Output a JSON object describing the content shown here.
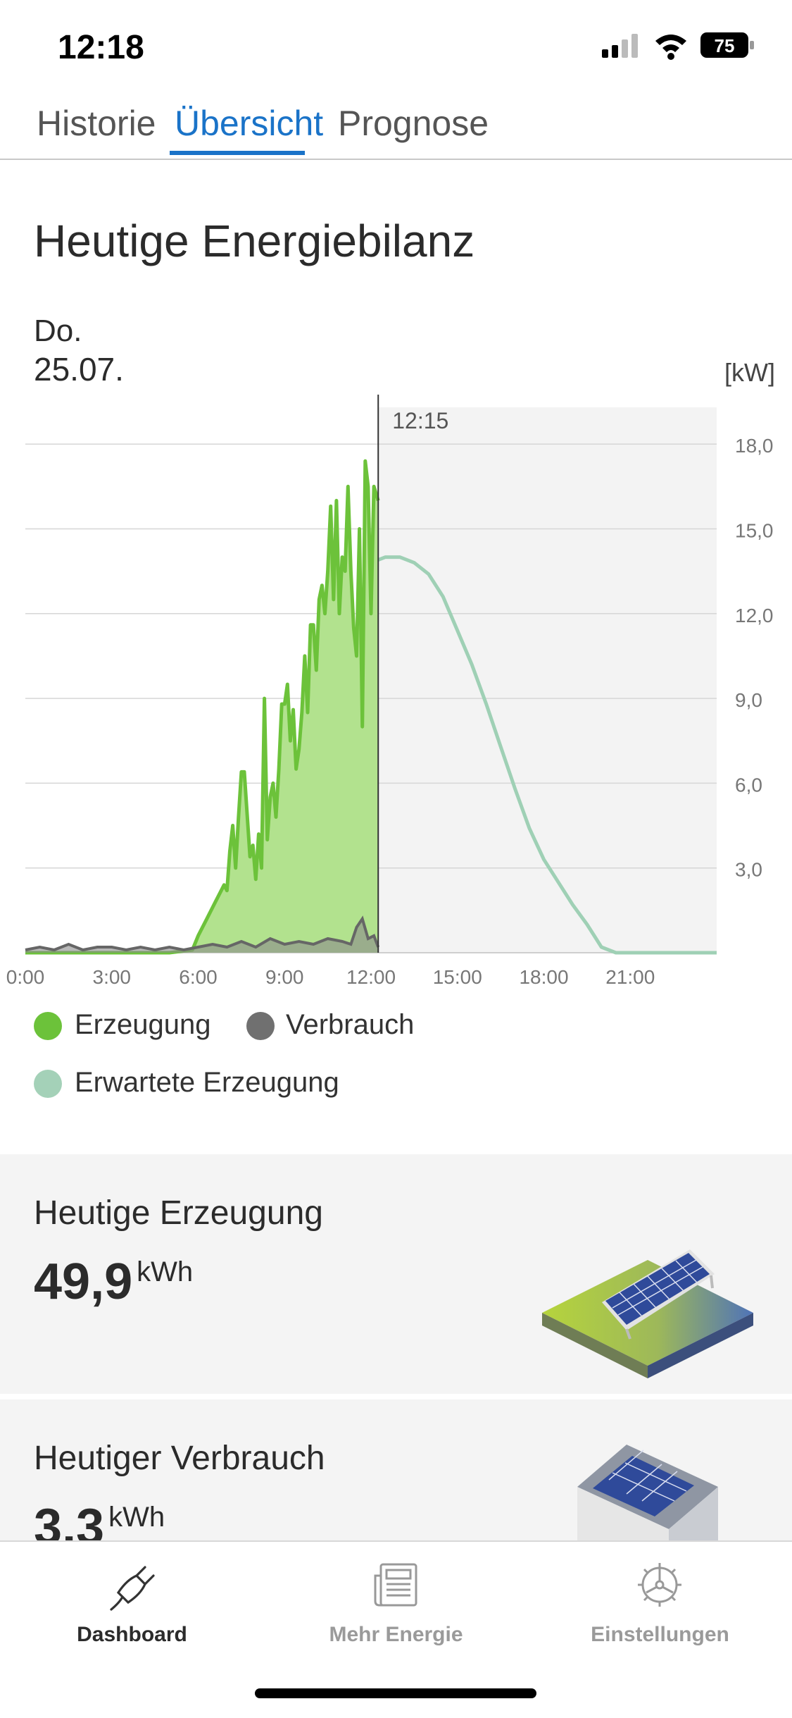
{
  "status_bar": {
    "time": "12:18",
    "battery": "75"
  },
  "tabs": [
    {
      "label": "Historie"
    },
    {
      "label": "Übersicht",
      "active": true
    },
    {
      "label": "Prognose"
    }
  ],
  "header": {
    "title": "Heutige Energiebilanz",
    "day": "Do.",
    "date": "25.07."
  },
  "chart_data": {
    "type": "area",
    "unit": "[kW]",
    "now_marker": "12:15",
    "now_hour": 12.25,
    "xlim": [
      0,
      24
    ],
    "ylim": [
      0,
      19.5
    ],
    "x_tick_labels": [
      "0:00",
      "3:00",
      "6:00",
      "9:00",
      "12:00",
      "15:00",
      "18:00",
      "21:00"
    ],
    "y_tick_labels": [
      "3,0",
      "6,0",
      "9,0",
      "12,0",
      "15,0",
      "18,0"
    ],
    "grid": true,
    "legend_position": "bottom",
    "colors": {
      "generation": "#6cc23a",
      "generation_fill": "#b2e28e",
      "consumption": "#666666",
      "expected": "#9fd0b5",
      "forecast_bg": "#f3f3f3"
    },
    "series": [
      {
        "name": "Erzeugung",
        "x": [
          0,
          1,
          2,
          3,
          4,
          5,
          5.8,
          6,
          6.3,
          6.6,
          6.9,
          7.0,
          7.1,
          7.2,
          7.3,
          7.4,
          7.5,
          7.6,
          7.8,
          7.9,
          8.0,
          8.1,
          8.2,
          8.3,
          8.4,
          8.5,
          8.6,
          8.7,
          8.8,
          8.9,
          9.0,
          9.1,
          9.2,
          9.3,
          9.4,
          9.5,
          9.6,
          9.7,
          9.8,
          9.9,
          10.0,
          10.1,
          10.2,
          10.3,
          10.4,
          10.5,
          10.6,
          10.7,
          10.8,
          10.9,
          11.0,
          11.1,
          11.2,
          11.3,
          11.4,
          11.5,
          11.6,
          11.7,
          11.8,
          11.9,
          12.0,
          12.1,
          12.25
        ],
        "y": [
          0,
          0,
          0,
          0,
          0,
          0,
          0.1,
          0.6,
          1.2,
          1.8,
          2.4,
          2.2,
          3.6,
          4.5,
          3.0,
          4.8,
          6.4,
          6.4,
          3.4,
          3.8,
          2.6,
          4.2,
          3.0,
          9.0,
          4.0,
          5.5,
          6.0,
          4.8,
          6.5,
          8.8,
          8.8,
          9.5,
          7.5,
          8.6,
          6.5,
          7.2,
          8.5,
          10.5,
          8.5,
          11.6,
          11.6,
          10.0,
          12.5,
          13.0,
          12.0,
          13.5,
          15.8,
          12.5,
          16.0,
          12.0,
          14.0,
          13.5,
          16.5,
          13.5,
          11.5,
          10.5,
          15.0,
          8.0,
          17.4,
          16.5,
          12.0,
          16.5,
          16.0
        ]
      },
      {
        "name": "Verbrauch",
        "x": [
          0,
          0.5,
          1,
          1.5,
          2,
          2.5,
          3,
          3.5,
          4,
          4.5,
          5,
          5.5,
          6,
          6.5,
          7,
          7.5,
          8,
          8.5,
          9,
          9.5,
          10,
          10.5,
          11,
          11.3,
          11.5,
          11.7,
          11.9,
          12.1,
          12.25
        ],
        "y": [
          0.1,
          0.2,
          0.1,
          0.3,
          0.1,
          0.2,
          0.2,
          0.1,
          0.2,
          0.1,
          0.2,
          0.1,
          0.2,
          0.3,
          0.2,
          0.4,
          0.2,
          0.5,
          0.3,
          0.4,
          0.3,
          0.5,
          0.4,
          0.3,
          0.9,
          1.2,
          0.5,
          0.6,
          0.2
        ]
      },
      {
        "name": "Erwartete Erzeugung",
        "x": [
          12.25,
          12.5,
          13,
          13.5,
          14,
          14.5,
          15,
          15.5,
          16,
          16.5,
          17,
          17.5,
          18,
          18.5,
          19,
          19.5,
          20,
          20.5,
          21,
          21.4,
          21.6,
          24
        ],
        "y": [
          13.9,
          14.0,
          14.0,
          13.8,
          13.4,
          12.6,
          11.4,
          10.2,
          8.8,
          7.3,
          5.8,
          4.4,
          3.3,
          2.5,
          1.7,
          1.0,
          0.2,
          -0.5,
          -1.2,
          -1.5,
          0,
          0
        ]
      }
    ]
  },
  "legend": [
    {
      "label": "Erzeugung",
      "color": "#6cc23a"
    },
    {
      "label": "Verbrauch",
      "color": "#707070"
    },
    {
      "label": "Erwartete Erzeugung",
      "color": "#a4d1b8"
    }
  ],
  "cards": {
    "generation": {
      "label": "Heutige Erzeugung",
      "value": "49,9",
      "unit": "kWh",
      "icon": "solar-panel-icon"
    },
    "consumption": {
      "label": "Heutiger Verbrauch",
      "value": "3,3",
      "unit": "kWh",
      "icon": "house-icon"
    }
  },
  "bottom_nav": [
    {
      "label": "Dashboard",
      "icon": "plug-icon",
      "active": true
    },
    {
      "label": "Mehr Energie",
      "icon": "newspaper-icon"
    },
    {
      "label": "Einstellungen",
      "icon": "gear-icon"
    }
  ]
}
